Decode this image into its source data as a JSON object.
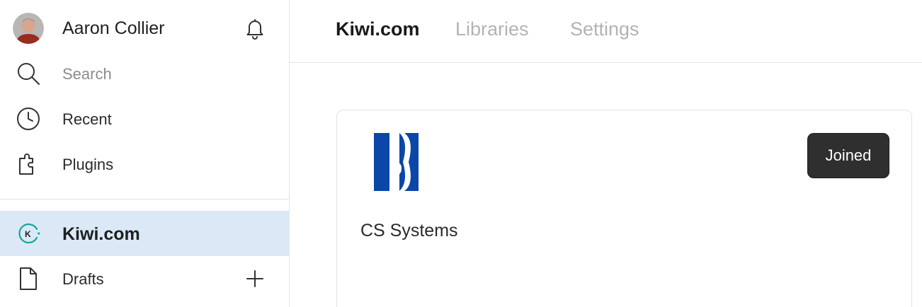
{
  "sidebar": {
    "user_name": "Aaron Collier",
    "nav": [
      {
        "label": "Search",
        "icon": "search-icon"
      },
      {
        "label": "Recent",
        "icon": "clock-icon"
      },
      {
        "label": "Plugins",
        "icon": "plugin-icon"
      }
    ],
    "team": {
      "label": "Kiwi.com",
      "icon": "team-logo-icon",
      "accent": "#16a596"
    },
    "drafts": {
      "label": "Drafts",
      "icon": "file-icon"
    }
  },
  "tabs": [
    {
      "label": "Kiwi.com",
      "active": true
    },
    {
      "label": "Libraries",
      "active": false
    },
    {
      "label": "Settings",
      "active": false
    }
  ],
  "org_card": {
    "name": "CS Systems",
    "logo_color": "#0b47a8",
    "action_label": "Joined"
  },
  "colors": {
    "selected_bg": "#dbe9f6",
    "button_bg": "#2f2f2f"
  }
}
